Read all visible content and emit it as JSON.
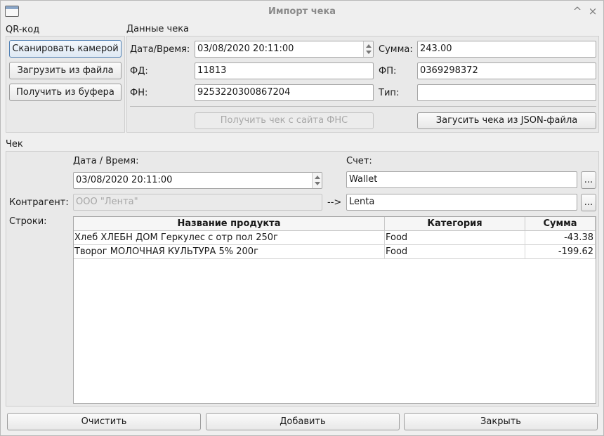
{
  "window": {
    "title": "Импорт чека",
    "collapse_icon": "^",
    "close_icon": "×"
  },
  "qr_group": {
    "title": "QR-код",
    "scan_camera": "Сканировать камерой",
    "load_file": "Загрузить из файла",
    "from_clipboard": "Получить из буфера"
  },
  "receipt_data": {
    "title": "Данные чека",
    "datetime_label": "Дата/Время:",
    "datetime_value": "03/08/2020 20:11:00",
    "sum_label": "Сумма:",
    "sum_value": "243.00",
    "fd_label": "ФД:",
    "fd_value": "11813",
    "fp_label": "ФП:",
    "fp_value": "0369298372",
    "fn_label": "ФН:",
    "fn_value": "9253220300867204",
    "type_label": "Тип:",
    "type_value": "",
    "get_fns": "Получить чек с сайта ФНС",
    "load_json": "Загусить чека из JSON-файла"
  },
  "check": {
    "title": "Чек",
    "datetime_label": "Дата / Время:",
    "datetime_value": "03/08/2020 20:11:00",
    "account_label": "Счет:",
    "account_value": "Wallet",
    "account_btn": "...",
    "counterparty_label": "Контрагент:",
    "counterparty_placeholder": "ООО \"Лента\"",
    "arrow": "-->",
    "counterparty_value": "Lenta",
    "counterparty_btn": "...",
    "lines_label": "Строки:",
    "columns": [
      "Название продукта",
      "Категория",
      "Сумма"
    ],
    "rows": [
      {
        "name": "Хлеб ХЛЕБН ДОМ Геркулес с отр пол 250г",
        "category": "Food",
        "sum": "-43.38"
      },
      {
        "name": "Творог МОЛОЧНАЯ КУЛЬТУРА 5% 200г",
        "category": "Food",
        "sum": "-199.62"
      }
    ]
  },
  "footer": {
    "clear": "Очистить",
    "add": "Добавить",
    "close": "Закрыть"
  }
}
